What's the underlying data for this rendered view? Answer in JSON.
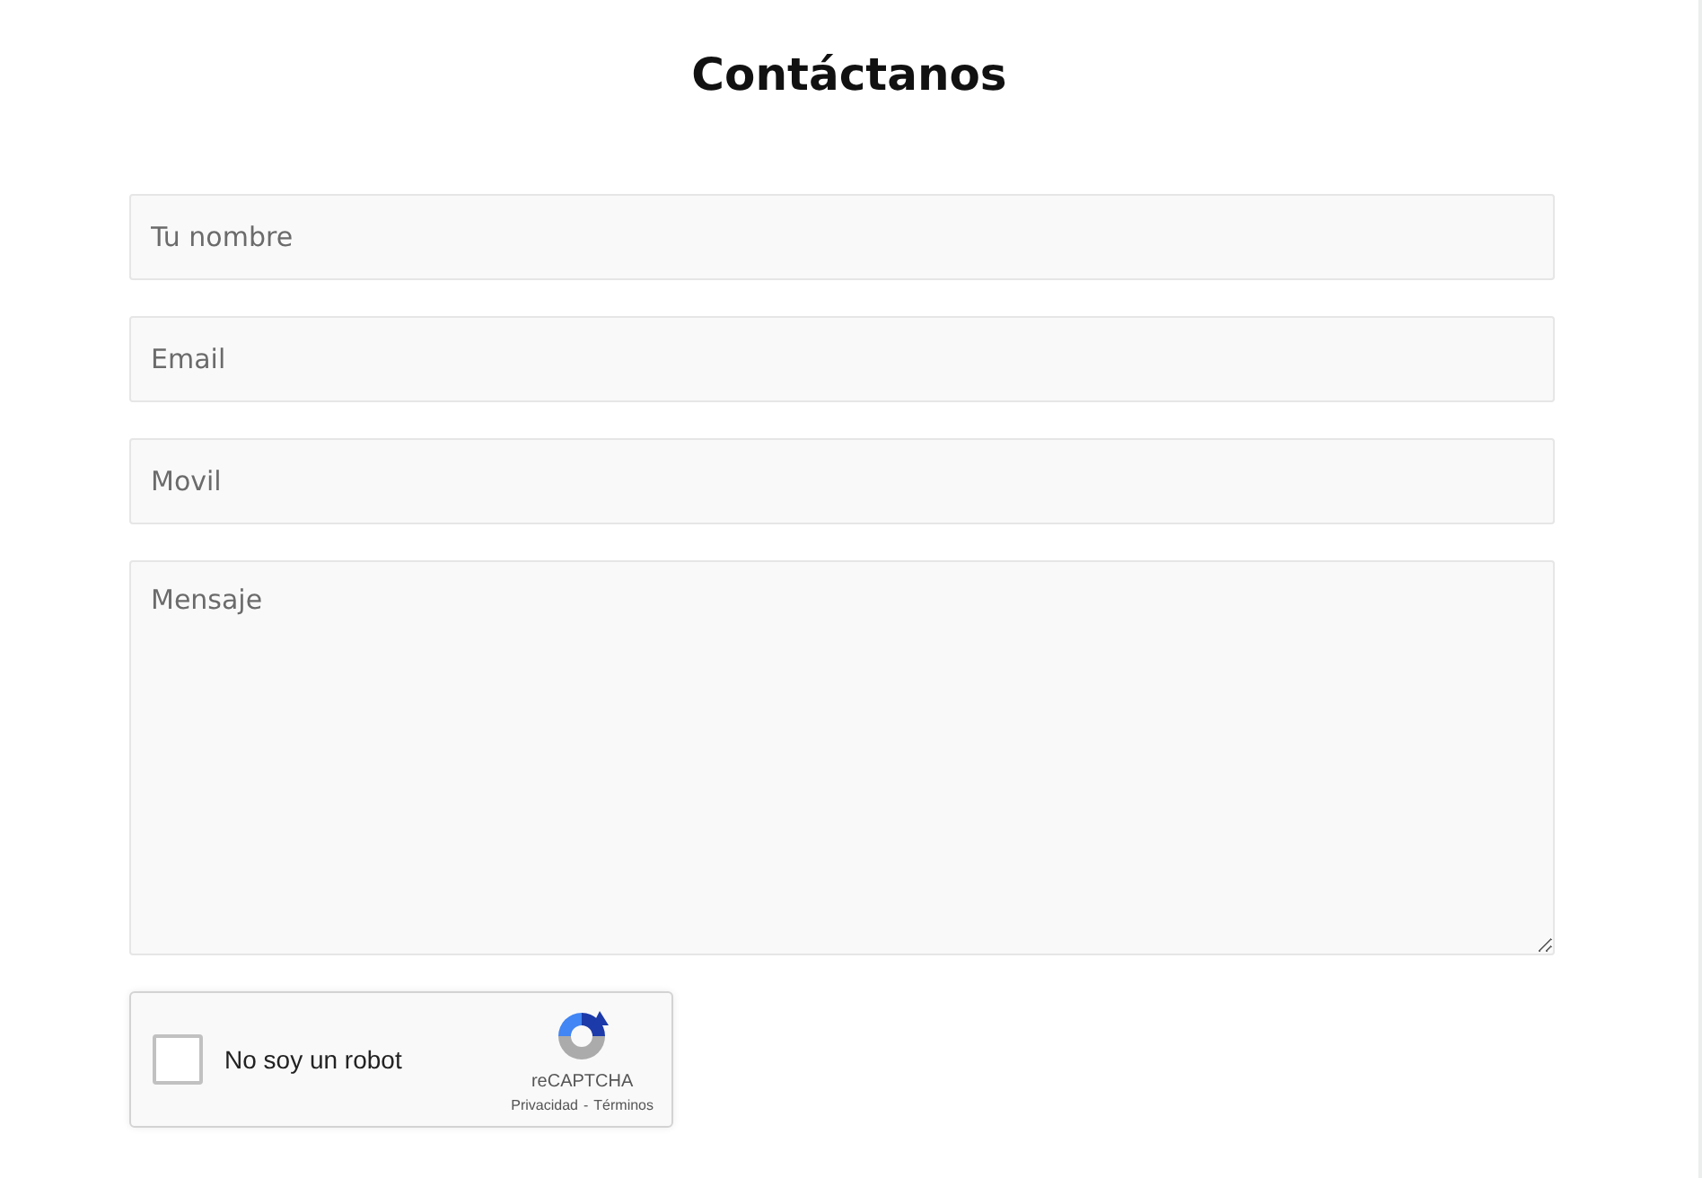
{
  "title": "Contáctanos",
  "fields": [
    {
      "kind": "input",
      "placeholder": "Tu nombre"
    },
    {
      "kind": "input",
      "placeholder": "Email"
    },
    {
      "kind": "input",
      "placeholder": "Movil"
    },
    {
      "kind": "textarea",
      "placeholder": "Mensaje"
    }
  ],
  "captcha": {
    "label": "No soy un robot",
    "checked": false,
    "brand": "reCAPTCHA",
    "privacy": "Privacidad",
    "separator": "-",
    "terms": "Términos"
  }
}
